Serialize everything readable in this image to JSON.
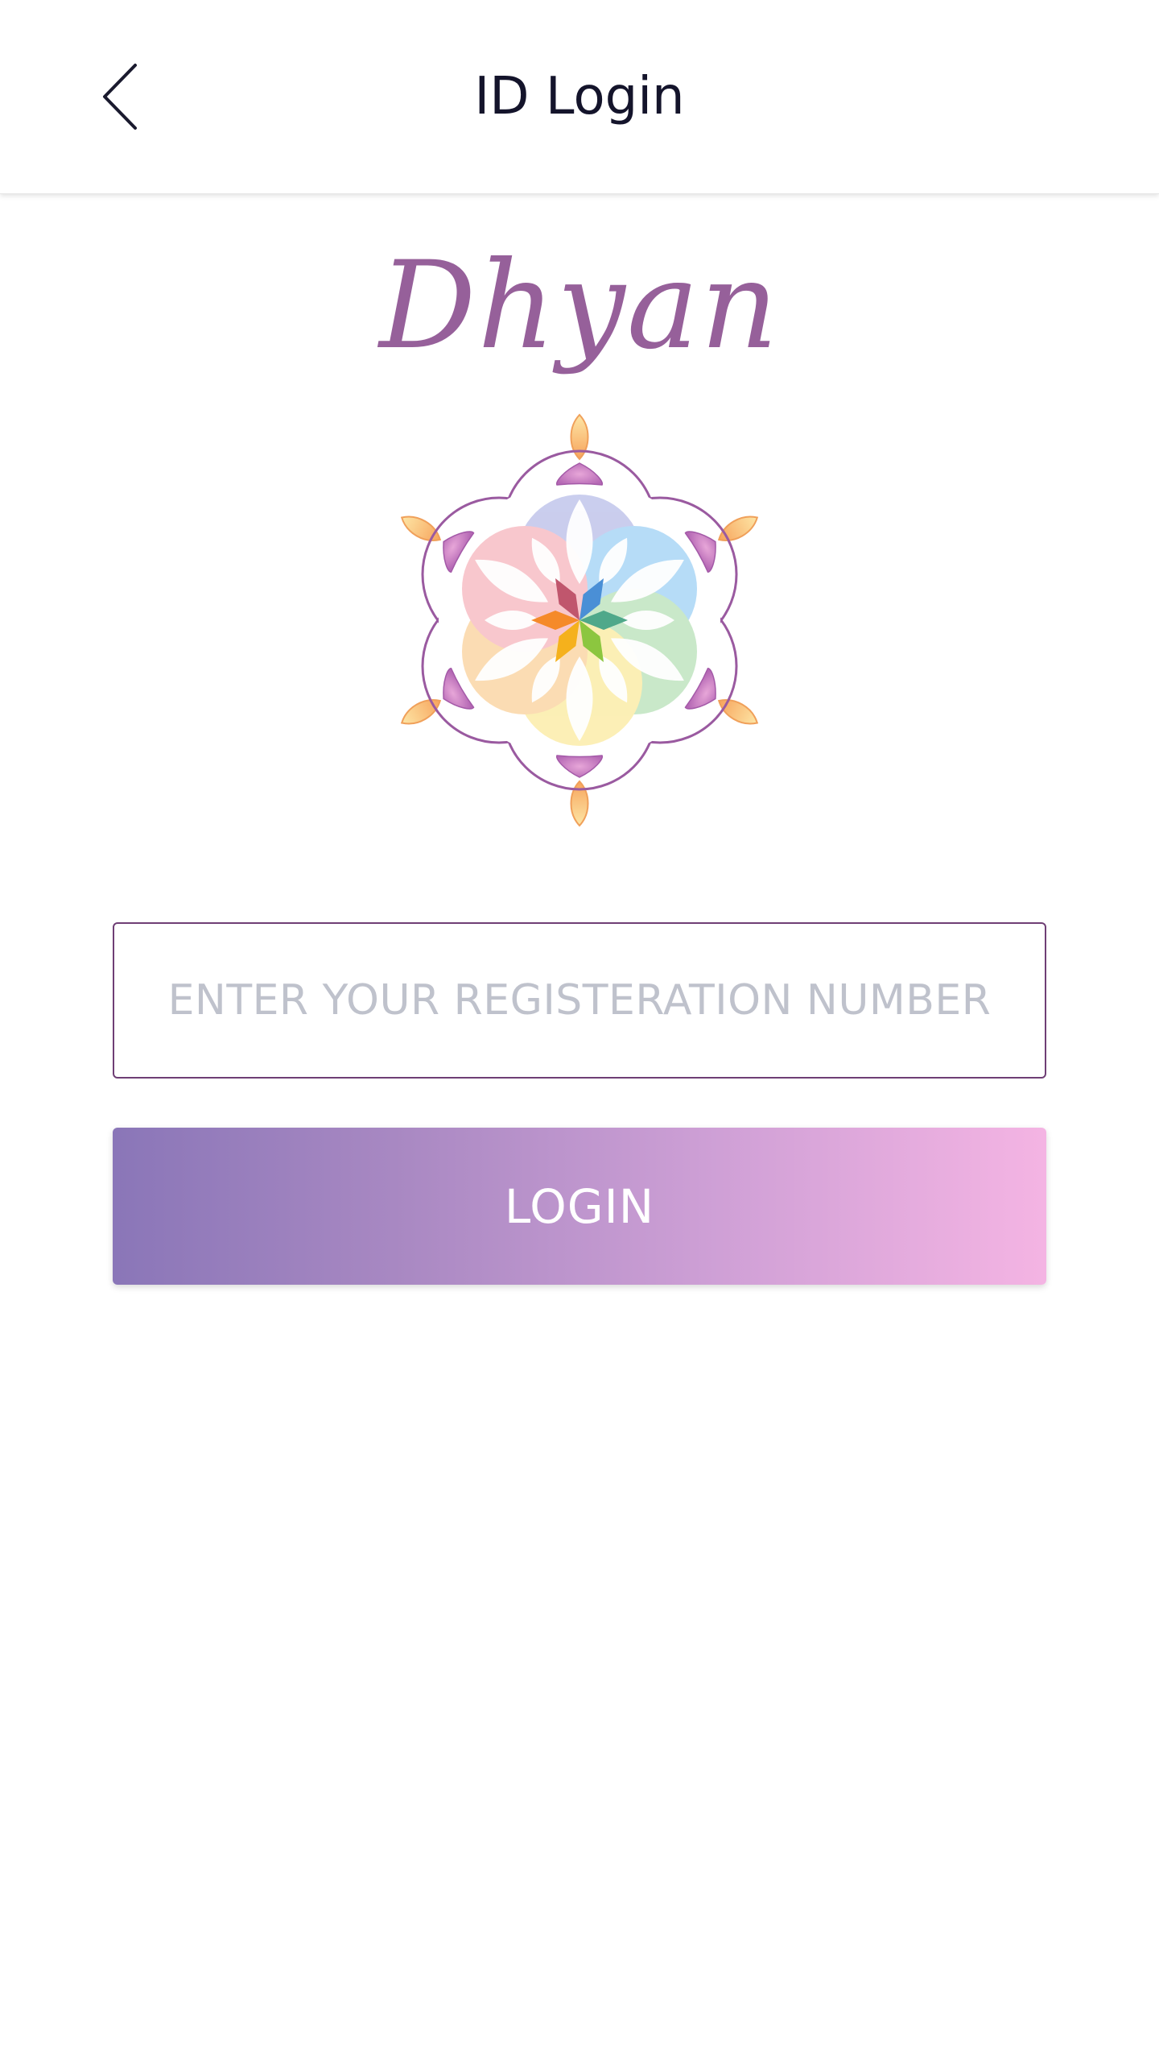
{
  "header": {
    "title": "ID Login",
    "back_icon": "chevron-left-icon"
  },
  "brand": {
    "wordmark": "Dhyan",
    "logo_icon": "flower-of-life-mandala-logo"
  },
  "form": {
    "registration_placeholder": "ENTER YOUR REGISTERATION NUMBER",
    "registration_value": "",
    "login_label": "LOGIN"
  },
  "colors": {
    "brand_purple": "#96609a",
    "input_border": "#6f3f75",
    "button_gradient_start": "#8a76b8",
    "button_gradient_end": "#f4b4e3",
    "title_text": "#14142b",
    "placeholder_text": "#bfc2cc"
  }
}
